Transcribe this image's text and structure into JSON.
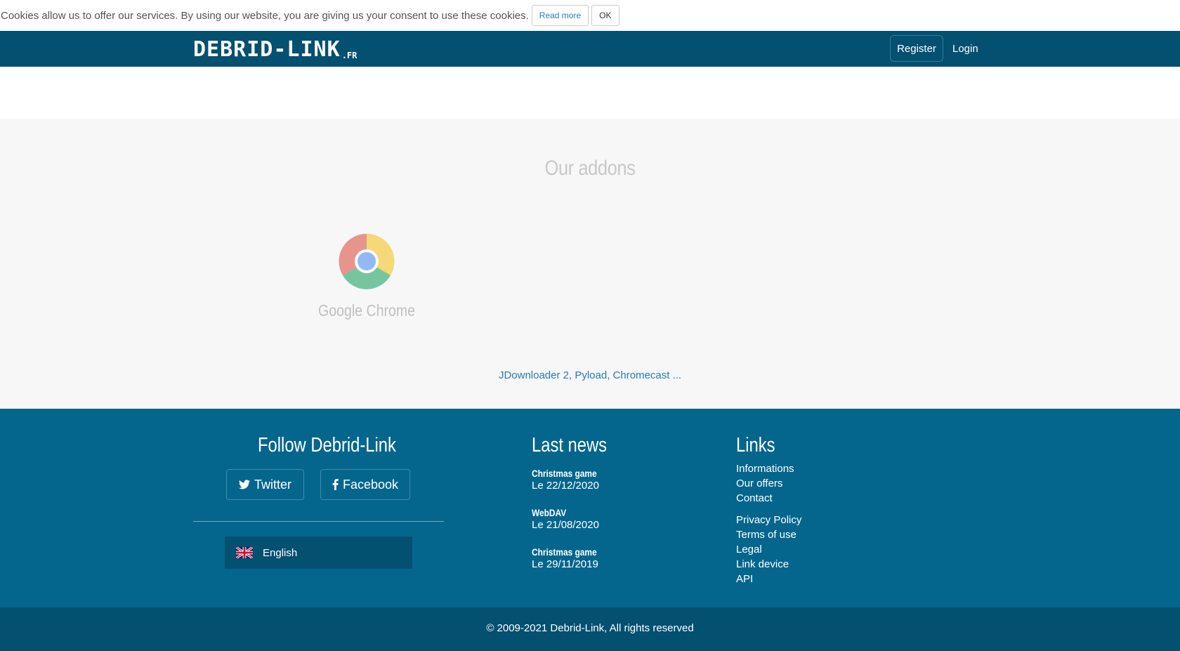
{
  "cookie": {
    "message": "Cookies allow us to offer our services. By using our website, you are giving us your consent to use these cookies.",
    "read_more": "Read more",
    "ok": "OK"
  },
  "navbar": {
    "logo_main": "DEBRID-LINK",
    "logo_tld": ".FR",
    "register": "Register",
    "login": "Login"
  },
  "addons": {
    "title": "Our addons",
    "items": [
      {
        "label": "Google Chrome",
        "icon": "chrome-icon"
      }
    ],
    "more": "JDownloader 2, Pyload, Chromecast ..."
  },
  "footer": {
    "follow_title": "Follow Debrid-Link",
    "twitter": "Twitter",
    "facebook": "Facebook",
    "language": "English",
    "news_title": "Last news",
    "news": [
      {
        "name": "Christmas game",
        "date": "Le 22/12/2020"
      },
      {
        "name": "WebDAV",
        "date": "Le 21/08/2020"
      },
      {
        "name": "Christmas game",
        "date": "Le 29/11/2019"
      }
    ],
    "links_title": "Links",
    "links": [
      "Informations",
      "Our offers",
      "Contact",
      "Privacy Policy",
      "Terms of use",
      "Legal",
      "Link device",
      "API"
    ],
    "copyright": "© 2009-2021 Debrid-Link, All rights reserved"
  },
  "colors": {
    "navbar": "#045071",
    "footer": "#05668d",
    "link": "#2a7ab8"
  }
}
